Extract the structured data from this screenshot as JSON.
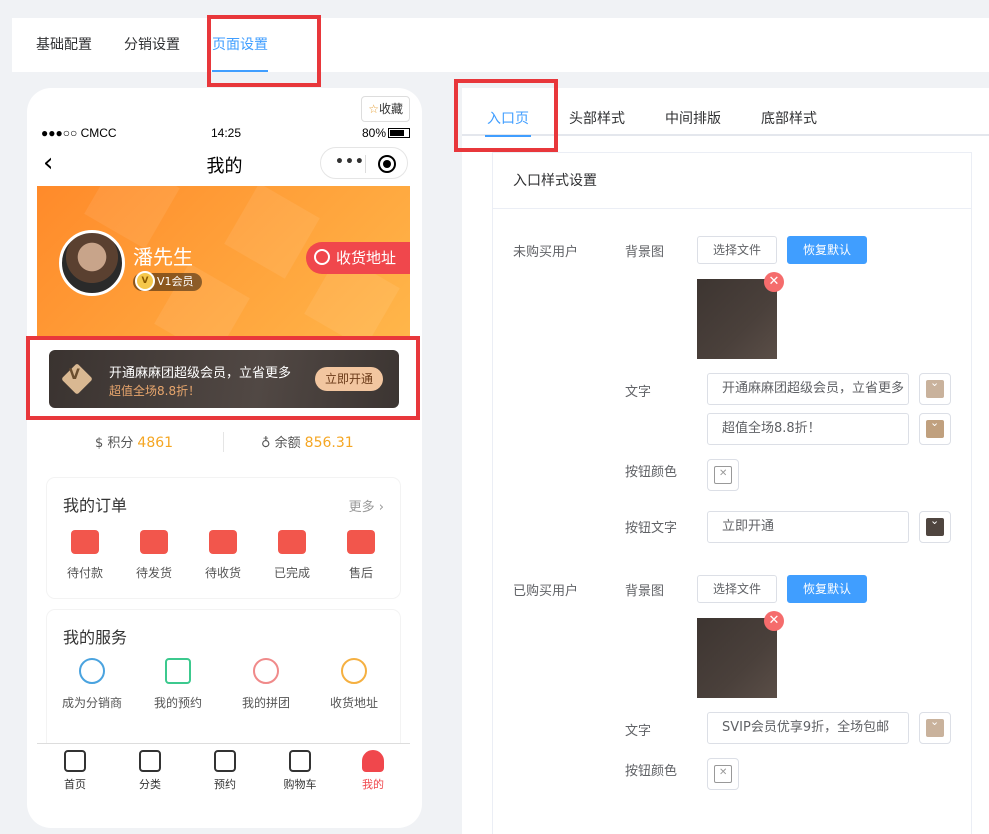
{
  "top_tabs": [
    "基础配置",
    "分销设置",
    "页面设置"
  ],
  "phone": {
    "favorite": "收藏",
    "status": {
      "carrier": "●●●○○ CMCC",
      "time": "14:25",
      "battery": "80%"
    },
    "nav_title": "我的",
    "user_name": "潘先生",
    "vip_level": "V1会员",
    "address_btn": "收货地址",
    "vip_card": {
      "line1": "开通麻麻团超级会员，立省更多",
      "line2": "超值全场8.8折！",
      "button": "立即开通"
    },
    "points_label": "积分",
    "points_value": "4861",
    "balance_label": "余额",
    "balance_value": "856.31",
    "orders": {
      "title": "我的订单",
      "more": "更多",
      "items": [
        "待付款",
        "待发货",
        "待收货",
        "已完成",
        "售后"
      ]
    },
    "services": {
      "title": "我的服务",
      "items": [
        "成为分销商",
        "我的预约",
        "我的拼团",
        "收货地址"
      ]
    },
    "tabbar": [
      "首页",
      "分类",
      "预约",
      "购物车",
      "我的"
    ]
  },
  "sub_tabs": [
    "入口页",
    "头部样式",
    "中间排版",
    "底部样式"
  ],
  "card_title": "入口样式设置",
  "unpurchased": {
    "label": "未购买用户",
    "bg_label": "背景图",
    "choose_file": "选择文件",
    "restore": "恢复默认",
    "text_label": "文字",
    "text1": "开通麻麻团超级会员，立省更多",
    "text2": "超值全场8.8折！",
    "btn_color_label": "按钮颜色",
    "btn_text_label": "按钮文字",
    "btn_text": "立即开通"
  },
  "purchased": {
    "label": "已购买用户",
    "bg_label": "背景图",
    "choose_file": "选择文件",
    "restore": "恢复默认",
    "text_label": "文字",
    "text1": "SVIP会员优享9折，全场包邮",
    "btn_color_label": "按钮颜色"
  },
  "colors": {
    "accent": "#409eff",
    "highlight": "#e8373b",
    "swatch1": "#c9b29c",
    "swatch2": "#c0a07e",
    "swatch3": "#4f453f"
  }
}
